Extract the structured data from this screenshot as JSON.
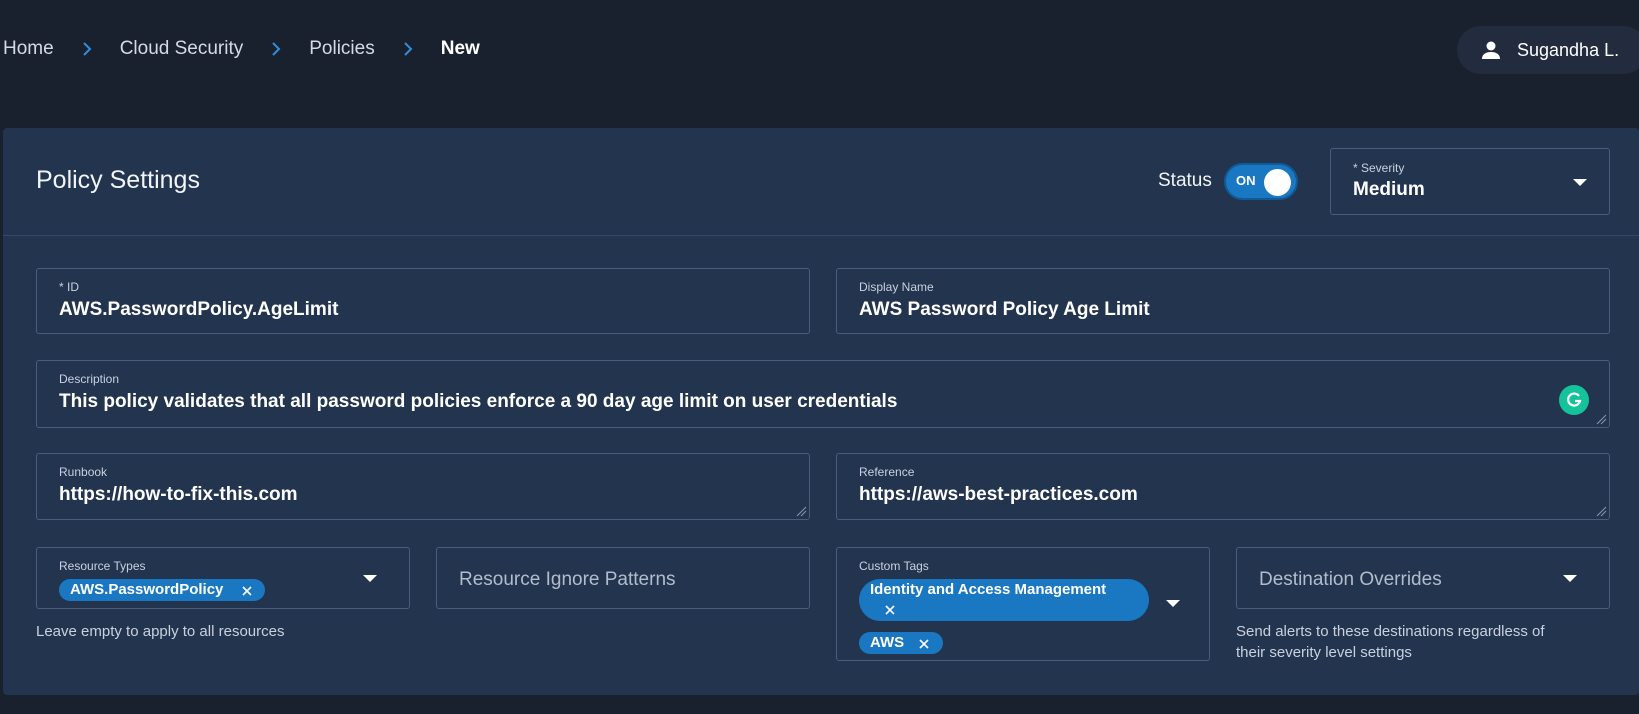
{
  "breadcrumb": [
    "Home",
    "Cloud Security",
    "Policies",
    "New"
  ],
  "user": {
    "name": "Sugandha L.",
    "icon": "person-icon"
  },
  "panel": {
    "title": "Policy Settings",
    "status_label": "Status",
    "status_toggle": "ON",
    "status_on": true,
    "severity": {
      "label": "* Severity",
      "value": "Medium"
    }
  },
  "fields": {
    "id": {
      "label": "* ID",
      "value": "AWS.PasswordPolicy.AgeLimit"
    },
    "display_name": {
      "label": "Display Name",
      "value": "AWS Password Policy Age Limit"
    },
    "description": {
      "label": "Description",
      "value": "This policy validates that all password policies enforce a 90 day age limit on user credentials"
    },
    "runbook": {
      "label": "Runbook",
      "value": "https://how-to-fix-this.com"
    },
    "reference": {
      "label": "Reference",
      "value": "https://aws-best-practices.com"
    },
    "resource_types": {
      "label": "Resource Types",
      "chips": [
        "AWS.PasswordPolicy"
      ],
      "helper": "Leave empty to apply to all resources"
    },
    "resource_ignore": {
      "placeholder": "Resource Ignore Patterns"
    },
    "custom_tags": {
      "label": "Custom Tags",
      "chips": [
        "Identity and Access Management",
        "AWS"
      ]
    },
    "destination_overrides": {
      "placeholder": "Destination Overrides",
      "helper_line1": "Send alerts to these destinations regardless of",
      "helper_line2": "their severity level settings"
    }
  },
  "colors": {
    "background": "#19202e",
    "panel": "#23344f",
    "accent": "#1a78c2",
    "grammarly": "#15c39a"
  }
}
